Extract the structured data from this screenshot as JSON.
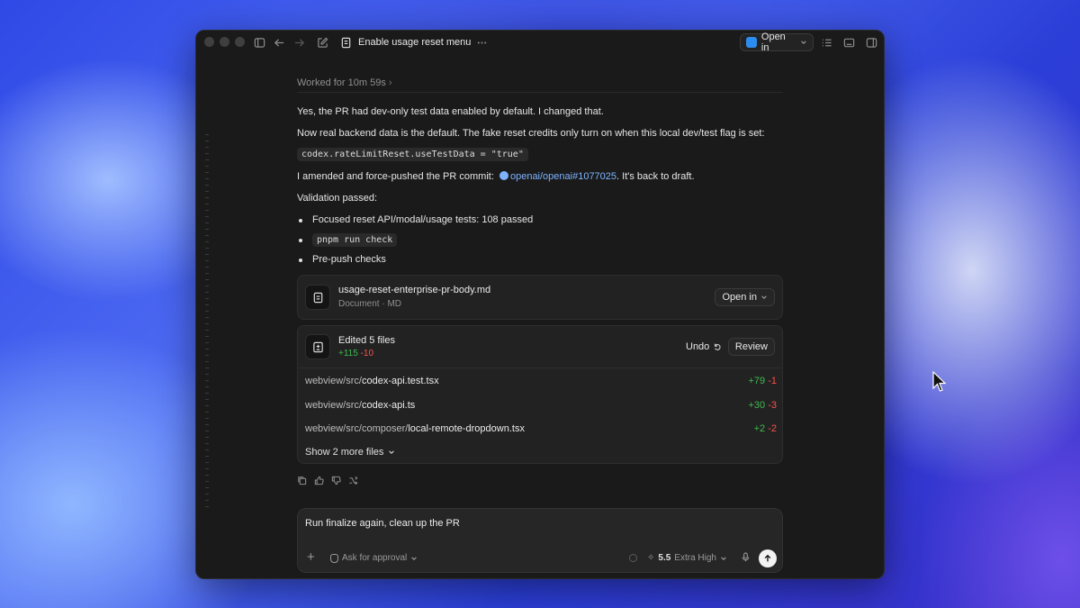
{
  "window": {
    "title": "Enable usage reset menu",
    "open_in_label": "Open in"
  },
  "worked": "Worked for 10m 59s",
  "messages": {
    "p1": "Yes, the PR had dev-only test data enabled by default. I changed that.",
    "p2": "Now real backend data is the default. The fake reset credits only turn on when this local dev/test flag is set:",
    "code1": "codex.rateLimitReset.useTestData = \"true\"",
    "p3_pre": "I amended and force-pushed the PR commit:",
    "p3_link": "openai/openai#1077025",
    "p3_post": ". It's back to draft.",
    "p4": "Validation passed:",
    "bullets": [
      "Focused reset API/modal/usage tests: 108 passed",
      "pnpm run check",
      "Pre-push checks"
    ]
  },
  "doc_card": {
    "filename": "usage-reset-enterprise-pr-body.md",
    "meta": "Document · MD",
    "open_in_label": "Open in"
  },
  "edits_card": {
    "title": "Edited 5 files",
    "added": "+115",
    "removed": "-10",
    "undo_label": "Undo",
    "review_label": "Review",
    "files": [
      {
        "dir": "webview/src/",
        "name": "codex-api.test.tsx",
        "added": "+79",
        "removed": "-1"
      },
      {
        "dir": "webview/src/",
        "name": "codex-api.ts",
        "added": "+30",
        "removed": "-3"
      },
      {
        "dir": "webview/src/composer/",
        "name": "local-remote-dropdown.tsx",
        "added": "+2",
        "removed": "-2"
      }
    ],
    "show_more": "Show 2 more files"
  },
  "composer": {
    "text": "Run finalize again, clean up the PR",
    "approval": "Ask for approval",
    "model": "5.5",
    "effort": "Extra High"
  },
  "colors": {
    "accent_green": "#3fb950",
    "accent_red": "#f85149",
    "link": "#7db3ff"
  }
}
